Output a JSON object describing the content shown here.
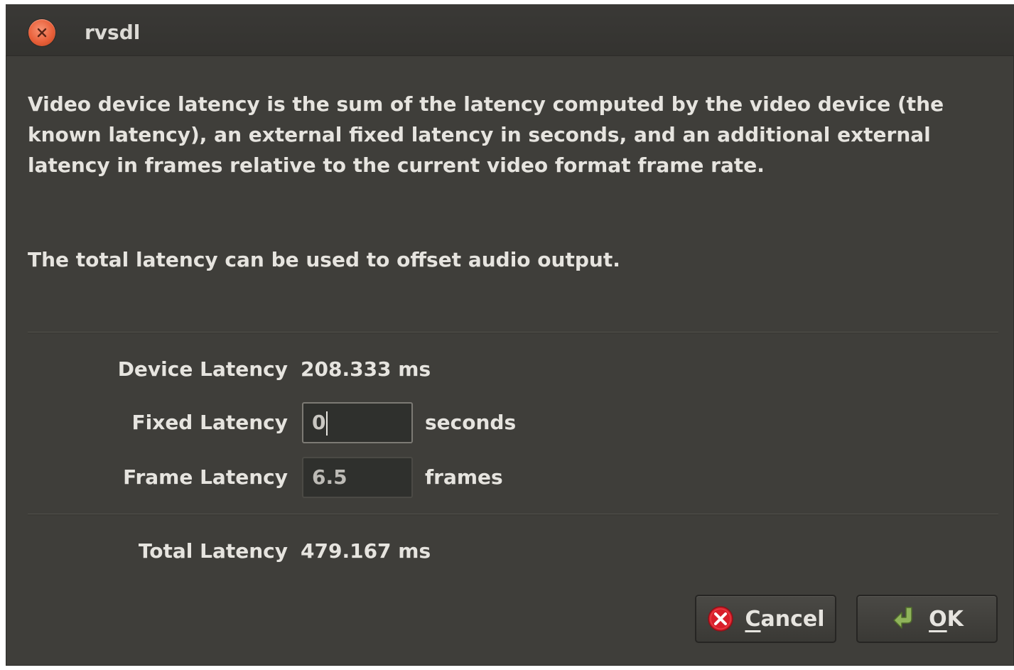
{
  "window": {
    "title": "rvsdl"
  },
  "description": {
    "paragraph1_lines": [
      "Video device latency is the sum of the latency computed by the video device (the",
      "known latency), an external fixed latency in seconds, and an additional external",
      "latency in frames relative to the current video format frame rate."
    ],
    "paragraph2": "The total latency can be used to offset audio output."
  },
  "device_latency": {
    "label": "Device Latency",
    "value": "208.333 ms"
  },
  "fixed_latency": {
    "label": "Fixed Latency",
    "value": "0",
    "unit": "seconds"
  },
  "frame_latency": {
    "label": "Frame Latency",
    "value": "6.5",
    "unit": "frames"
  },
  "total_latency": {
    "label": "Total Latency",
    "value": "479.167 ms"
  },
  "buttons": {
    "cancel": {
      "mnemonic": "C",
      "rest": "ancel",
      "icon": "cancel-icon",
      "icon_color": "#d81e2a"
    },
    "ok": {
      "mnemonic": "O",
      "rest": "K",
      "icon": "ok-arrow-icon",
      "icon_color": "#8fb35a"
    }
  },
  "colors": {
    "background": "#3f3e3a",
    "text": "#e6e4df",
    "close_button": "#e9603a"
  }
}
